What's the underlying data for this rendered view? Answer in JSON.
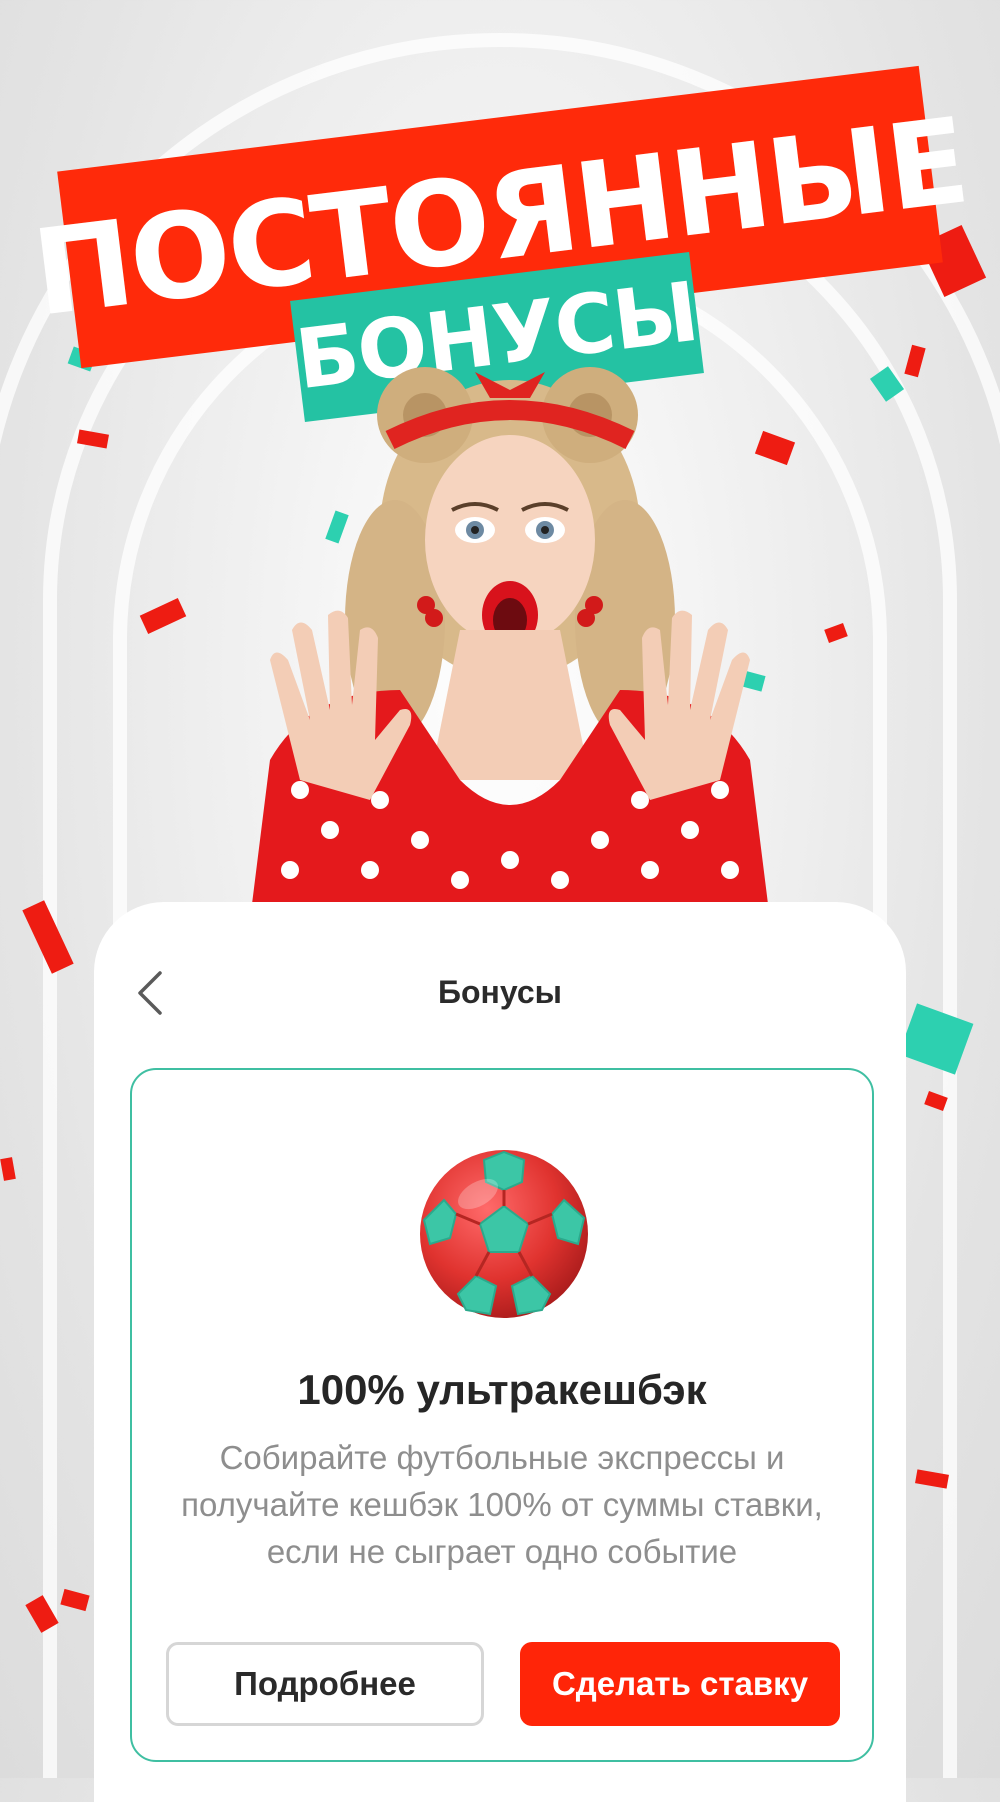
{
  "promo": {
    "headline_line1": "ПОСТОЯННЫЕ",
    "headline_line2": "БОНУСЫ",
    "accent_red": "#ff2a0a",
    "accent_green": "#24c2a3"
  },
  "header": {
    "title": "Бонусы",
    "back_icon": "chevron-left-icon"
  },
  "bonus_card": {
    "image": "soccer-ball-icon",
    "title": "100% ультракешбэк",
    "description": "Собирайте футбольные экспрессы и получайте кешбэк 100% от суммы ставки, если не сыграет одно событие",
    "secondary_button": "Подробнее",
    "primary_button": "Сделать ставку",
    "border_color": "#3fbfa2"
  }
}
